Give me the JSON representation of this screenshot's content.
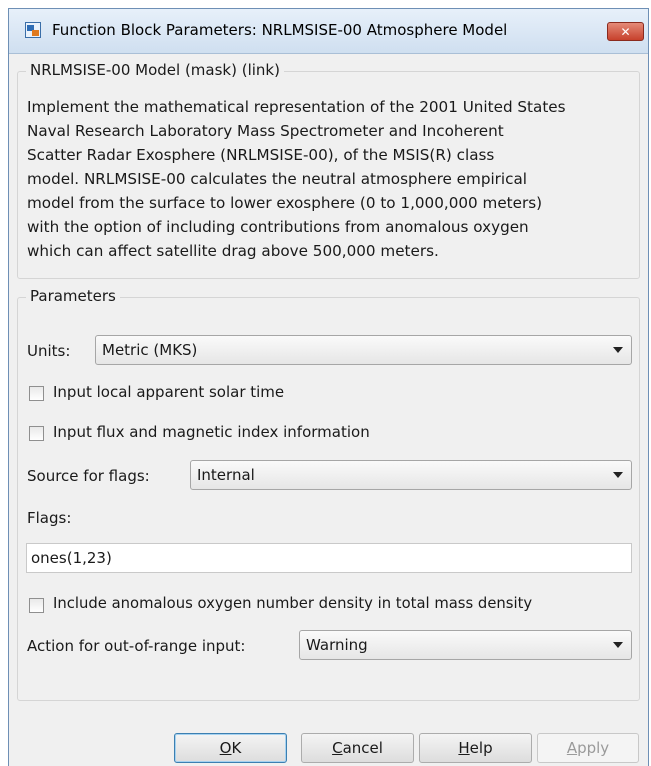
{
  "window": {
    "title": "Function Block Parameters: NRLMSISE-00 Atmosphere Model",
    "close_symbol": "✕"
  },
  "mask": {
    "legend": "NRLMSISE-00 Model (mask) (link)",
    "description_lines": [
      "Implement the mathematical representation of the 2001 United States",
      "Naval Research Laboratory Mass Spectrometer and Incoherent",
      "Scatter Radar Exosphere (NRLMSISE-00), of the MSIS(R) class",
      "model. NRLMSISE-00 calculates the neutral atmosphere empirical",
      "model from the surface to lower exosphere (0 to 1,000,000 meters)",
      "with the option of including contributions from anomalous oxygen",
      "which can affect satellite drag above 500,000 meters."
    ]
  },
  "parameters": {
    "legend": "Parameters",
    "units": {
      "label": "Units:",
      "value": "Metric (MKS)"
    },
    "local_solar_time": {
      "label": "Input local apparent solar time",
      "checked": false
    },
    "flux_magnetic": {
      "label": "Input flux and magnetic index information",
      "checked": false
    },
    "source_flags": {
      "label": "Source for flags:",
      "value": "Internal"
    },
    "flags": {
      "label": "Flags:",
      "value": "ones(1,23)"
    },
    "anomalous_oxygen": {
      "label": "Include anomalous oxygen number density in total mass density",
      "checked": false
    },
    "out_of_range": {
      "label": "Action for out-of-range input:",
      "value": "Warning"
    }
  },
  "buttons": {
    "ok": "OK",
    "cancel": "Cancel",
    "help": "Help",
    "apply": "Apply"
  },
  "icons": {
    "app": "simulink-block-icon",
    "close": "close-icon",
    "dropdown": "chevron-down-icon"
  },
  "colors": {
    "titlebar": "#cfdff0",
    "close_button": "#c7412c",
    "dialog_background": "#f0f0f0"
  }
}
